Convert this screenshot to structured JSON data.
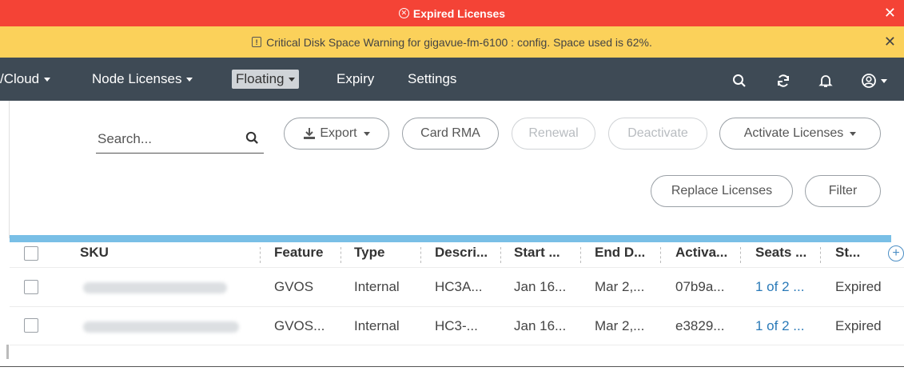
{
  "banners": {
    "expired": {
      "text": "Expired Licenses",
      "icon": "x-circle-icon",
      "close": "✕",
      "color": "#f44336"
    },
    "warning": {
      "text": "Critical Disk Space Warning for gigavue-fm-6100 : config. Space used is 62%.",
      "icon": "warning-box-icon",
      "close": "✕",
      "color": "#fbd15a"
    }
  },
  "nav": {
    "items": [
      {
        "label": "/Cloud",
        "has_caret": true
      },
      {
        "label": "Node Licenses",
        "has_caret": true
      },
      {
        "label": "Floating",
        "has_caret": true,
        "active": true
      },
      {
        "label": "Expiry",
        "has_caret": false
      },
      {
        "label": "Settings",
        "has_caret": false
      }
    ],
    "icons": [
      "search-icon",
      "refresh-icon",
      "bell-icon",
      "user-icon"
    ],
    "background": "#3e4a55"
  },
  "toolbar": {
    "search_placeholder": "Search...",
    "export_label": "Export",
    "card_rma_label": "Card RMA",
    "renewal_label": "Renewal",
    "deactivate_label": "Deactivate",
    "activate_label": "Activate Licenses",
    "replace_label": "Replace Licenses",
    "filter_label": "Filter"
  },
  "table": {
    "columns": [
      "SKU",
      "Feature",
      "Type",
      "Descri...",
      "Start ...",
      "End D...",
      "Activa...",
      "Seats ...",
      "St..."
    ],
    "rows": [
      {
        "feature": "GVOS",
        "type": "Internal",
        "desc": "HC3A...",
        "start": "Jan 16...",
        "end": "Mar 2,...",
        "activation": "07b9a...",
        "seats": "1 of 2 ...",
        "status": "Expired"
      },
      {
        "feature": "GVOS...",
        "type": "Internal",
        "desc": "HC3-...",
        "start": "Jan 16...",
        "end": "Mar 2,...",
        "activation": "e3829...",
        "seats": "1 of 2 ...",
        "status": "Expired"
      }
    ],
    "add_column": "+",
    "accent": "#79bfe6",
    "link_color": "#2a7ab8"
  }
}
